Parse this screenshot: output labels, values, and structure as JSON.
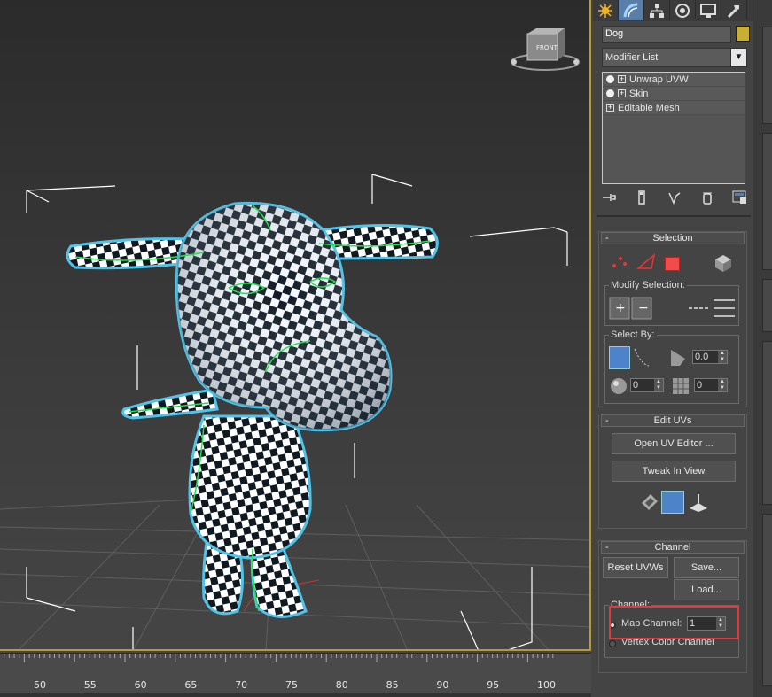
{
  "viewport": {
    "gizmo_label": "FRONT",
    "grid_axis_color": "#cc3333"
  },
  "timeline": {
    "ticks": [
      "50",
      "55",
      "60",
      "65",
      "70",
      "75",
      "80",
      "85",
      "90",
      "95",
      "100"
    ]
  },
  "command_panel": {
    "tabs": [
      "create-icon",
      "modify-icon",
      "hierarchy-icon",
      "motion-icon",
      "display-icon",
      "utilities-icon"
    ],
    "active_tab": "modify-icon",
    "object_name": "Dog",
    "object_color": "#c9ad34",
    "modifier_list_label": "Modifier List",
    "modifier_stack": [
      {
        "label": "Unwrap UVW",
        "has_bulb": true
      },
      {
        "label": "Skin",
        "has_bulb": true
      },
      {
        "label": "Editable Mesh",
        "has_bulb": false
      }
    ],
    "selection": {
      "title": "Selection",
      "modify_selection_label": "Modify Selection:",
      "select_by_label": "Select By:",
      "angle_value": "0.0",
      "spinner_a": "0",
      "spinner_b": "0"
    },
    "edit_uvs": {
      "title": "Edit UVs",
      "open_editor": "Open UV Editor ...",
      "tweak_in_view": "Tweak In View"
    },
    "channel": {
      "title": "Channel",
      "reset_uvws": "Reset UVWs",
      "save": "Save...",
      "load": "Load...",
      "channel_group_label": "Channel:",
      "map_channel_label": "Map Channel:",
      "map_channel_value": "1",
      "vertex_color_label": "Vertex Color Channel"
    }
  }
}
